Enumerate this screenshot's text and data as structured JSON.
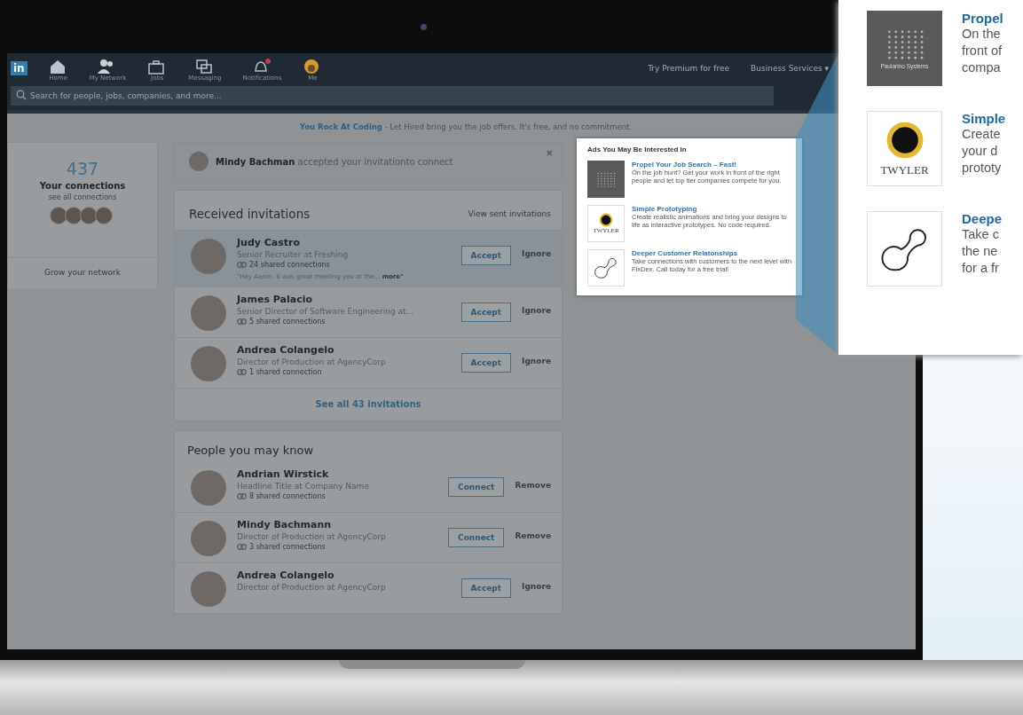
{
  "nav": {
    "logo": "in",
    "items": [
      {
        "label": "Home",
        "badge": false
      },
      {
        "label": "My Network",
        "badge": false
      },
      {
        "label": "Jobs",
        "badge": false
      },
      {
        "label": "Messaging",
        "badge": false
      },
      {
        "label": "Notifications",
        "badge": true
      },
      {
        "label": "Me",
        "badge": false
      }
    ],
    "premium": "Try Premium for free",
    "business": "Business Services ▾",
    "search": {
      "placeholder": "Search for people, jobs, companies, and more..."
    }
  },
  "banner": {
    "highlight": "You Rock At Coding",
    "text": "- Let Hired bring you the job offers. It's free, and no commitment."
  },
  "connections": {
    "count": "437",
    "label": "Your connections",
    "link": "see all connections",
    "grow": "Grow your network"
  },
  "notice": {
    "name": "Mindy Bachman",
    "text": "accepted your invitationto connect",
    "close": "×"
  },
  "invitations": {
    "title": "Received invitations",
    "link": "View sent invitations",
    "see_all": "See all 43 invitations",
    "rows": [
      {
        "name": "Judy Castro",
        "headline": "Senior Recruiter at Freshing",
        "shared": "24 shared connections",
        "message": "\"Hey Aaron, it was great meeting you at the...",
        "more": "more\"",
        "selected": true,
        "primary": "Accept",
        "secondary": "Ignore"
      },
      {
        "name": "James Palacio",
        "headline": "Senior Director of Software Engineering at...",
        "shared": "5 shared connections",
        "selected": false,
        "primary": "Accept",
        "secondary": "Ignore"
      },
      {
        "name": "Andrea Colangelo",
        "headline": "Director of Production at AgencyCorp",
        "shared": "1 shared connection",
        "selected": false,
        "primary": "Accept",
        "secondary": "Ignore"
      }
    ]
  },
  "pymk": {
    "title": "People you may know",
    "rows": [
      {
        "name": "Andrian Wirstick",
        "headline": "Headline Title at Company Name",
        "shared": "8 shared connections",
        "primary": "Connect",
        "secondary": "Remove"
      },
      {
        "name": "Mindy Bachmann",
        "headline": "Director of Production at AgencyCorp",
        "shared": "3 shared connections",
        "primary": "Connect",
        "secondary": "Remove"
      },
      {
        "name": "Andrea Colangelo",
        "headline": "Director of Production at AgencyCorp",
        "primary": "Accept",
        "secondary": "Ignore"
      }
    ]
  },
  "ads": {
    "title": "Ads You May Be Interested In",
    "items": [
      {
        "kind": "grid",
        "title": "Propel Your Job Search – Fast!",
        "text": "On the job hunt? Get your work in front of the right people and let top tier companies compete for you."
      },
      {
        "kind": "ring",
        "logo_text": "TWYLER",
        "title": "Simple Prototyping",
        "text": "Create realistic animations and bring your designs to life as interactive prototypes. No code required."
      },
      {
        "kind": "blob",
        "title": "Deeper Customer Relatonships",
        "text": "Take connections with customers to the next level with FixDex. Call today for a free trial!"
      }
    ]
  },
  "callout": {
    "items": [
      {
        "kind": "grid",
        "logo_text": "Paularino Systems",
        "title": "Propel",
        "lines": [
          "On the",
          "front of",
          "compa"
        ]
      },
      {
        "kind": "ring",
        "logo_text": "TWYLER",
        "title": "Simple",
        "lines": [
          "Create",
          "your d",
          "prototy"
        ]
      },
      {
        "kind": "blob",
        "title": "Deepe",
        "lines": [
          "Take c",
          "the ne",
          "for a fr"
        ]
      }
    ]
  }
}
